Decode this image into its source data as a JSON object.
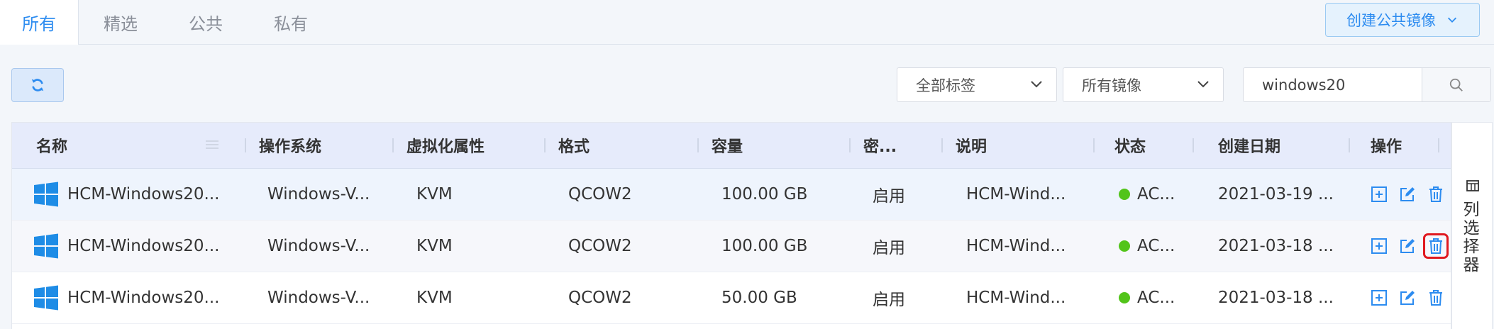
{
  "tabs": [
    {
      "label": "所有",
      "active": true
    },
    {
      "label": "精选",
      "active": false
    },
    {
      "label": "公共",
      "active": false
    },
    {
      "label": "私有",
      "active": false
    }
  ],
  "create_button": {
    "label": "创建公共镜像"
  },
  "toolbar": {
    "refresh_icon": "refresh-icon",
    "tag_filter": {
      "selected": "全部标签"
    },
    "image_filter": {
      "selected": "所有镜像"
    },
    "search": {
      "value": "windows20"
    }
  },
  "table": {
    "columns": [
      "名称",
      "操作系统",
      "虚拟化属性",
      "格式",
      "容量",
      "密...",
      "说明",
      "状态",
      "创建日期",
      "操作"
    ],
    "rows": [
      {
        "name": "HCM-Windows20...",
        "os": "Windows-V...",
        "virt": "KVM",
        "format": "QCOW2",
        "capacity": "100.00 GB",
        "encrypt": "启用",
        "desc": "HCM-Wind...",
        "status": "AC...",
        "created": "2021-03-19 ..."
      },
      {
        "name": "HCM-Windows20...",
        "os": "Windows-V...",
        "virt": "KVM",
        "format": "QCOW2",
        "capacity": "100.00 GB",
        "encrypt": "启用",
        "desc": "HCM-Wind...",
        "status": "AC...",
        "created": "2021-03-18 ..."
      },
      {
        "name": "HCM-Windows20...",
        "os": "Windows-V...",
        "virt": "KVM",
        "format": "QCOW2",
        "capacity": "50.00 GB",
        "encrypt": "启用",
        "desc": "HCM-Wind...",
        "status": "AC...",
        "created": "2021-03-18 ..."
      }
    ]
  },
  "column_selector": {
    "label": "列选择器"
  },
  "colors": {
    "accent": "#2d8cf0",
    "status_active": "#52c41a",
    "highlight": "#e0191f",
    "header_bg": "#e6ebfb"
  }
}
